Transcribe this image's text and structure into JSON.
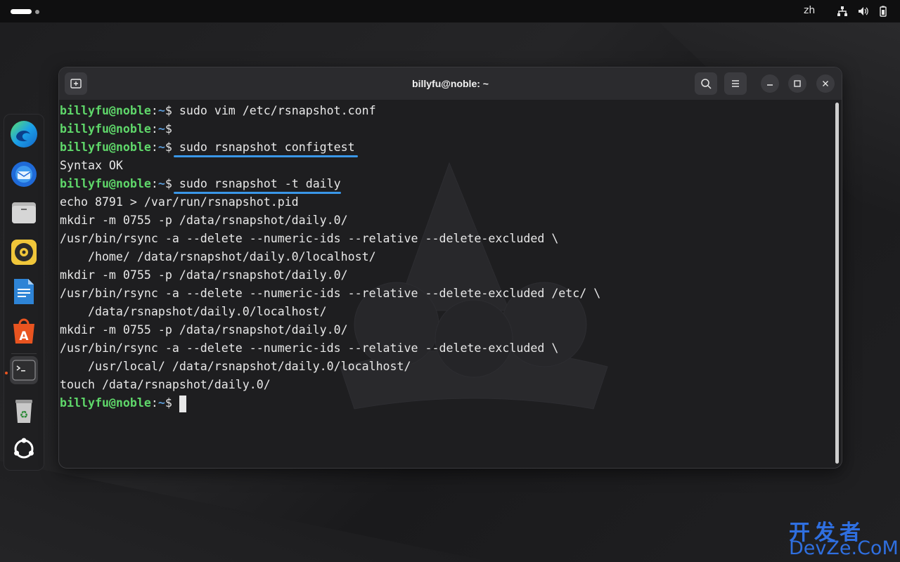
{
  "topbar": {
    "input_method": "zh",
    "tray_icons": [
      "network-icon",
      "volume-icon",
      "battery-icon"
    ]
  },
  "dock": {
    "apps": [
      {
        "name": "edge-browser-icon"
      },
      {
        "name": "thunderbird-icon"
      },
      {
        "name": "files-icon"
      },
      {
        "name": "rhythmbox-icon"
      },
      {
        "name": "libreoffice-writer-icon"
      },
      {
        "name": "app-center-icon"
      },
      {
        "name": "terminal-icon"
      },
      {
        "name": "trash-icon"
      },
      {
        "name": "show-apps-icon"
      }
    ]
  },
  "window": {
    "title": "billyfu@noble: ~"
  },
  "terminal": {
    "prompt_user": "billyfu@noble",
    "prompt_sep": ":",
    "prompt_dir": "~",
    "prompt_symbol": "$",
    "commands": {
      "c1": "sudo vim /etc/rsnapshot.conf",
      "c2": "",
      "c3": "sudo rsnapshot configtest",
      "c4": "sudo rsnapshot -t daily",
      "c5": ""
    },
    "output": {
      "o1": "Syntax OK",
      "o2": "echo 8791 > /var/run/rsnapshot.pid",
      "o3": "mkdir -m 0755 -p /data/rsnapshot/daily.0/",
      "o4": "/usr/bin/rsync -a --delete --numeric-ids --relative --delete-excluded \\",
      "o5": "    /home/ /data/rsnapshot/daily.0/localhost/",
      "o6": "mkdir -m 0755 -p /data/rsnapshot/daily.0/",
      "o7": "/usr/bin/rsync -a --delete --numeric-ids --relative --delete-excluded /etc/ \\",
      "o8": "    /data/rsnapshot/daily.0/localhost/",
      "o9": "mkdir -m 0755 -p /data/rsnapshot/daily.0/",
      "o10": "/usr/bin/rsync -a --delete --numeric-ids --relative --delete-excluded \\",
      "o11": "    /usr/local/ /data/rsnapshot/daily.0/localhost/",
      "o12": "touch /data/rsnapshot/daily.0/"
    },
    "colors": {
      "prompt_user": "#5fd76a",
      "prompt_dir": "#5a9ad6",
      "highlight_underline": "#3a97e8"
    }
  },
  "watermark": {
    "line1": "开发者",
    "line2": "DevZe.CoM"
  }
}
